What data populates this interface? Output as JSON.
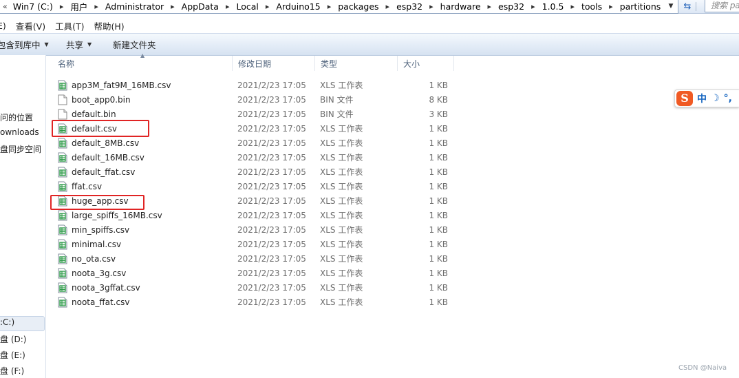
{
  "address": {
    "lead": "«",
    "crumbs": [
      "Win7 (C:)",
      "用户",
      "Administrator",
      "AppData",
      "Local",
      "Arduino15",
      "packages",
      "esp32",
      "hardware",
      "esp32",
      "1.0.5",
      "tools",
      "partitions"
    ],
    "search_placeholder": "搜索 pa"
  },
  "menu": [
    "E)",
    "查看(V)",
    "工具(T)",
    "帮助(H)"
  ],
  "toolbar": {
    "include_label": "包含到库中",
    "share_label": "共享",
    "new_folder_label": "新建文件夹"
  },
  "nav": {
    "items": [
      "问的位置",
      "ownloads",
      "盘同步空间"
    ],
    "drives": [
      ":C:)",
      "盘 (D:)",
      "盘 (E:)",
      "盘 (F:)"
    ]
  },
  "columns": {
    "name": "名称",
    "date": "修改日期",
    "type": "类型",
    "size": "大小"
  },
  "files": [
    {
      "name": "app3M_fat9M_16MB.csv",
      "date": "2021/2/23 17:05",
      "type": "XLS 工作表",
      "size": "1 KB",
      "icon": "spreadsheet-icon"
    },
    {
      "name": "boot_app0.bin",
      "date": "2021/2/23 17:05",
      "type": "BIN 文件",
      "size": "8 KB",
      "icon": "blank-file-icon"
    },
    {
      "name": "default.bin",
      "date": "2021/2/23 17:05",
      "type": "BIN 文件",
      "size": "3 KB",
      "icon": "blank-file-icon"
    },
    {
      "name": "default.csv",
      "date": "2021/2/23 17:05",
      "type": "XLS 工作表",
      "size": "1 KB",
      "icon": "spreadsheet-icon"
    },
    {
      "name": "default_8MB.csv",
      "date": "2021/2/23 17:05",
      "type": "XLS 工作表",
      "size": "1 KB",
      "icon": "spreadsheet-icon"
    },
    {
      "name": "default_16MB.csv",
      "date": "2021/2/23 17:05",
      "type": "XLS 工作表",
      "size": "1 KB",
      "icon": "spreadsheet-icon"
    },
    {
      "name": "default_ffat.csv",
      "date": "2021/2/23 17:05",
      "type": "XLS 工作表",
      "size": "1 KB",
      "icon": "spreadsheet-icon"
    },
    {
      "name": "ffat.csv",
      "date": "2021/2/23 17:05",
      "type": "XLS 工作表",
      "size": "1 KB",
      "icon": "spreadsheet-icon"
    },
    {
      "name": "huge_app.csv",
      "date": "2021/2/23 17:05",
      "type": "XLS 工作表",
      "size": "1 KB",
      "icon": "spreadsheet-icon"
    },
    {
      "name": "large_spiffs_16MB.csv",
      "date": "2021/2/23 17:05",
      "type": "XLS 工作表",
      "size": "1 KB",
      "icon": "spreadsheet-icon"
    },
    {
      "name": "min_spiffs.csv",
      "date": "2021/2/23 17:05",
      "type": "XLS 工作表",
      "size": "1 KB",
      "icon": "spreadsheet-icon"
    },
    {
      "name": "minimal.csv",
      "date": "2021/2/23 17:05",
      "type": "XLS 工作表",
      "size": "1 KB",
      "icon": "spreadsheet-icon"
    },
    {
      "name": "no_ota.csv",
      "date": "2021/2/23 17:05",
      "type": "XLS 工作表",
      "size": "1 KB",
      "icon": "spreadsheet-icon"
    },
    {
      "name": "noota_3g.csv",
      "date": "2021/2/23 17:05",
      "type": "XLS 工作表",
      "size": "1 KB",
      "icon": "spreadsheet-icon"
    },
    {
      "name": "noota_3gffat.csv",
      "date": "2021/2/23 17:05",
      "type": "XLS 工作表",
      "size": "1 KB",
      "icon": "spreadsheet-icon"
    },
    {
      "name": "noota_ffat.csv",
      "date": "2021/2/23 17:05",
      "type": "XLS 工作表",
      "size": "1 KB",
      "icon": "spreadsheet-icon"
    }
  ],
  "ime": {
    "logo": "S",
    "lang": "中",
    "moon": "☽",
    "punct": "°,"
  },
  "watermark": "CSDN @Naiva",
  "colors": {
    "highlight": "#e02424",
    "spreadsheet_icon": "#2e9b4a",
    "ime_logo": "#f05a24",
    "ime_text": "#1565c0"
  }
}
